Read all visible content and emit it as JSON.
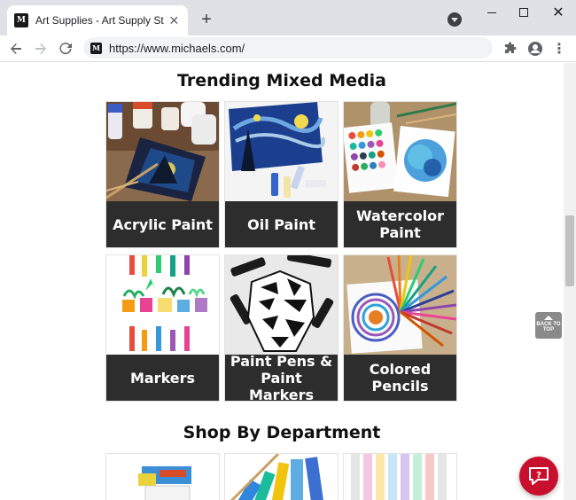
{
  "browser": {
    "tab_title": "Art Supplies - Art Supply Store | M",
    "favicon_text": "M",
    "url": "https://www.michaels.com/",
    "icons": [
      "close-icon",
      "plus-icon",
      "back-icon",
      "forward-icon",
      "reload-icon",
      "puzzle-icon",
      "account-icon",
      "menu-icon"
    ]
  },
  "page": {
    "section1_title": "Trending Mixed Media",
    "section2_title": "Shop By Department",
    "trending": [
      {
        "label": "Acrylic Paint"
      },
      {
        "label": "Oil Paint"
      },
      {
        "label": "Watercolor Paint"
      },
      {
        "label": "Markers"
      },
      {
        "label": "Paint Pens & Paint Markers"
      },
      {
        "label": "Colored Pencils"
      }
    ],
    "back_to_top": "BACK TO TOP",
    "accent_color": "#c8102e",
    "label_bg": "#2d2d2d"
  }
}
